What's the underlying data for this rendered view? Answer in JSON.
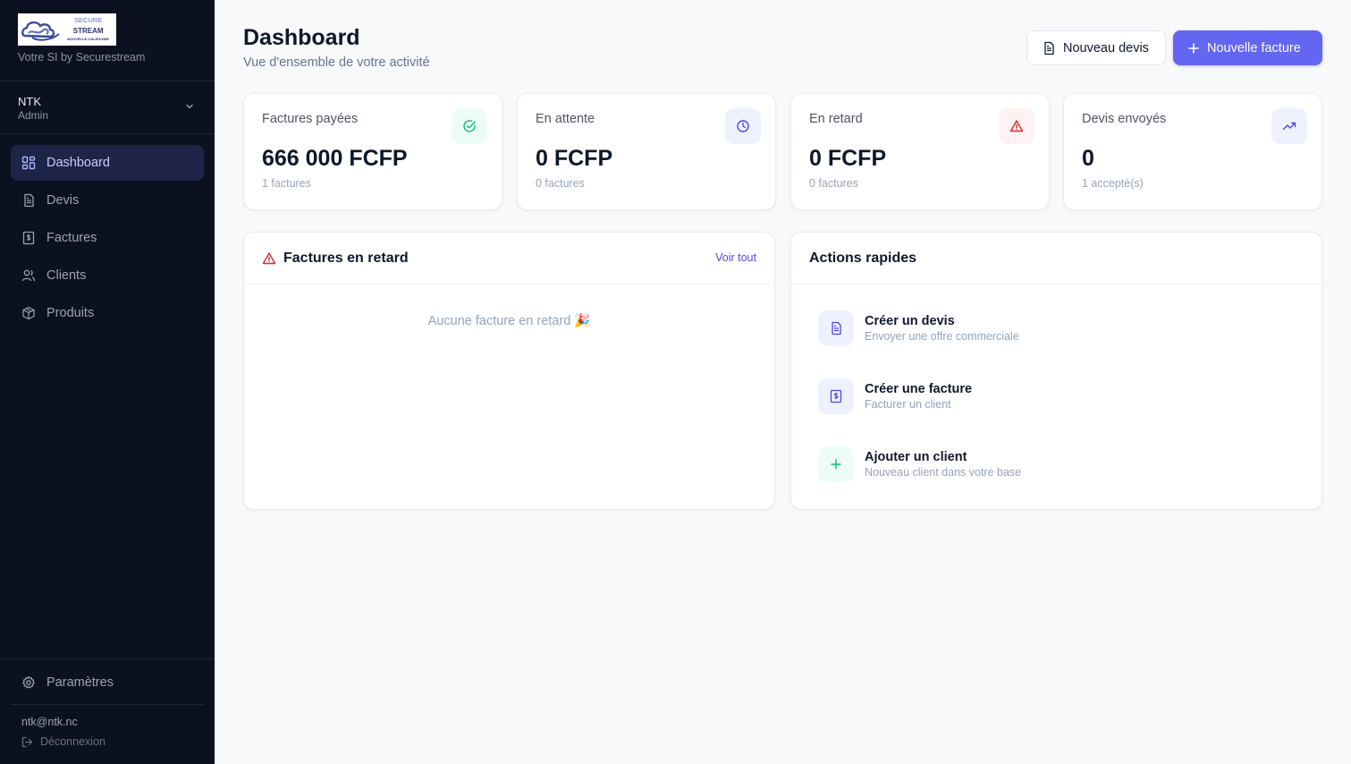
{
  "brand": {
    "logo_text": [
      "SECURE",
      "STREAM",
      "NOUVELLE-CALEDONIE"
    ],
    "subtitle": "Votre SI by Securestream"
  },
  "org": {
    "name": "NTK",
    "role": "Admin"
  },
  "nav": [
    {
      "label": "Dashboard",
      "icon": "dashboard-icon",
      "active": true
    },
    {
      "label": "Devis",
      "icon": "document-icon"
    },
    {
      "label": "Factures",
      "icon": "invoice-icon"
    },
    {
      "label": "Clients",
      "icon": "users-icon"
    },
    {
      "label": "Produits",
      "icon": "package-icon"
    }
  ],
  "settings_label": "Paramètres",
  "user": {
    "email": "ntk@ntk.nc",
    "logout": "Déconnexion"
  },
  "header": {
    "title": "Dashboard",
    "subtitle": "Vue d'ensemble de votre activité",
    "btn_devis": "Nouveau devis",
    "btn_facture": "Nouvelle facture"
  },
  "stats": [
    {
      "label": "Factures payées",
      "value": "666 000 FCFP",
      "sub": "1 factures",
      "icon": "check-circle-icon",
      "color": "#10b981"
    },
    {
      "label": "En attente",
      "value": "0 FCFP",
      "sub": "0 factures",
      "icon": "clock-icon",
      "color": "#4f46e5"
    },
    {
      "label": "En retard",
      "value": "0 FCFP",
      "sub": "0 factures",
      "icon": "warning-icon",
      "color": "#dc2626"
    },
    {
      "label": "Devis envoyés",
      "value": "0",
      "sub": "1 accepté(s)",
      "icon": "trending-up-icon",
      "color": "#4f46e5"
    }
  ],
  "overdue": {
    "title": "Factures en retard",
    "link": "Voir tout",
    "empty": "Aucune facture en retard 🎉"
  },
  "quick": {
    "title": "Actions rapides",
    "items": [
      {
        "title": "Créer un devis",
        "sub": "Envoyer une offre commerciale",
        "icon": "document-icon"
      },
      {
        "title": "Créer une facture",
        "sub": "Facturer un client",
        "icon": "invoice-icon"
      },
      {
        "title": "Ajouter un client",
        "sub": "Nouveau client dans votre base",
        "icon": "plus-icon"
      }
    ]
  },
  "colors": {
    "primary": "#6366f1",
    "sidebar": "#0b1120",
    "success": "#10b981",
    "danger": "#dc2626"
  }
}
